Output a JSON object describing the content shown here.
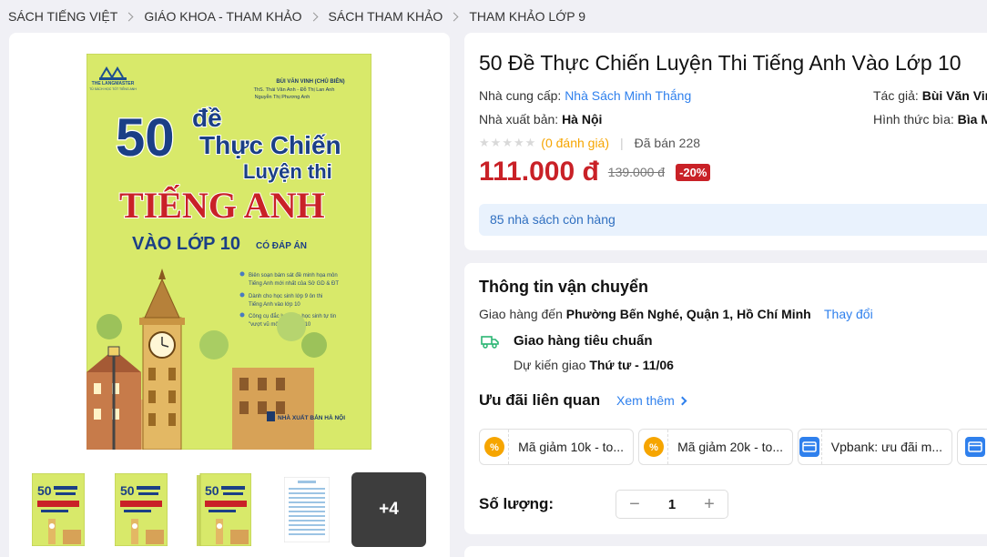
{
  "breadcrumb": [
    "SÁCH TIẾNG VIỆT",
    "GIÁO KHOA - THAM KHẢO",
    "SÁCH THAM KHẢO",
    "THAM KHẢO LỚP 9"
  ],
  "gallery": {
    "cover": {
      "brand": "THE LANGMASTER",
      "brand_sub": "TỦ SÁCH HỌC TỐT TIẾNG ANH",
      "author_main": "BÙI VĂN VINH (CHỦ BIÊN)",
      "author_line2": "ThS. Thái Vân Anh - Đỗ Thị Lan Anh",
      "author_line3": "Nguyễn Thị Phương Anh",
      "num": "50",
      "de": "đề",
      "thuc_chien": "Thực Chiến",
      "luyen_thi": "Luyện thi",
      "tieng_anh": "TIẾNG ANH",
      "vao_lop": "VÀO LỚP 10",
      "co_dap_an": "CÓ ĐÁP ÁN",
      "bullets": [
        "Biên soạn bám sát đề minh họa môn",
        "Tiếng Anh mới nhất của Sở GD & ĐT",
        "Dành cho học sinh lớp 9 ôn thi",
        "Tiếng Anh vào lớp 10",
        "Công cụ đắc lực giúp học sinh tự tin",
        "\"vượt vũ môn\" vào lớp 10"
      ],
      "publisher": "NHÀ XUẤT BẢN HÀ NỘI"
    },
    "more_label": "+4"
  },
  "product": {
    "title": "50 Đề Thực Chiến Luyện Thi Tiếng Anh Vào Lớp 10",
    "supplier_label": "Nhà cung cấp:",
    "supplier": "Nhà Sách Minh Thắng",
    "author_label": "Tác giả:",
    "author": "Bùi Văn Vinh",
    "publisher_label": "Nhà xuất bản:",
    "publisher": "Hà Nội",
    "cover_label": "Hình thức bìa:",
    "cover_type": "Bìa Mềm",
    "rating_text": "(0 đánh giá)",
    "rating_value": 0,
    "sold": "Đã bán 228",
    "price": "111.000 đ",
    "old_price": "139.000 đ",
    "discount": "-20%",
    "stock": "85 nhà sách còn hàng"
  },
  "shipping": {
    "title": "Thông tin vận chuyển",
    "to_label": "Giao hàng đến",
    "address": "Phường Bến Nghé, Quận 1, Hồ Chí Minh",
    "change": "Thay đổi",
    "method": "Giao hàng tiêu chuẩn",
    "eta_label": "Dự kiến giao",
    "eta": "Thứ tư - 11/06"
  },
  "promos": {
    "title": "Ưu đãi liên quan",
    "see_more": "Xem thêm",
    "items": [
      {
        "label": "Mã giảm 10k - to...",
        "icon": "percent-coupon-icon"
      },
      {
        "label": "Mã giảm 20k - to...",
        "icon": "percent-coupon-icon"
      },
      {
        "label": "Vpbank: ưu đãi m...",
        "icon": "card-icon"
      }
    ]
  },
  "quantity": {
    "label": "Số lượng:",
    "value": "1",
    "minus": "−",
    "plus": "+"
  },
  "colors": {
    "accent_red": "#c92127",
    "link_blue": "#2f80ed",
    "coupon_orange": "#f6a500",
    "card_blue": "#2f80ed"
  }
}
